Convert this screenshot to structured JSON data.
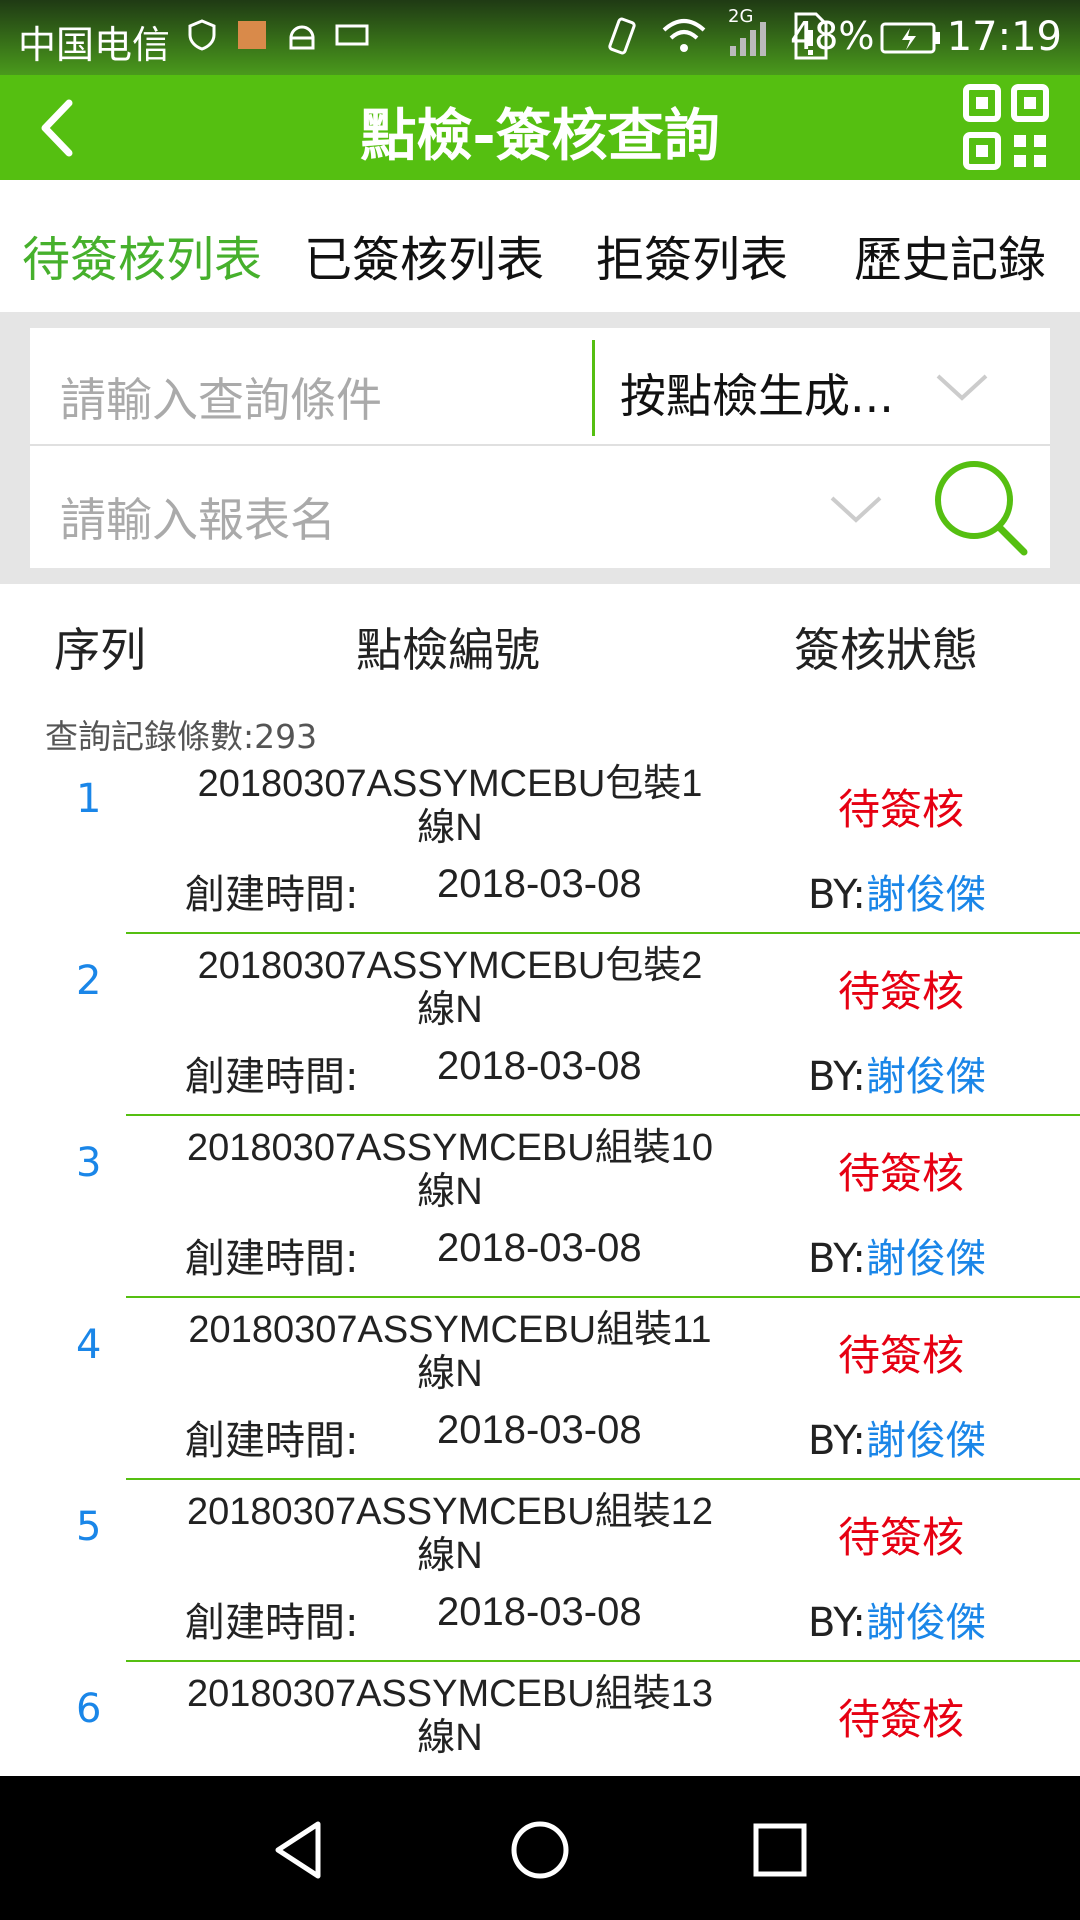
{
  "status_bar": {
    "carrier": "中国电信",
    "network": "2G",
    "battery": "48%",
    "time": "17:19"
  },
  "app_bar": {
    "title": "點檢-簽核查詢"
  },
  "tabs": [
    {
      "label": "待簽核列表",
      "active": true
    },
    {
      "label": "已簽核列表",
      "active": false
    },
    {
      "label": "拒簽列表",
      "active": false
    },
    {
      "label": "歷史記錄",
      "active": false
    }
  ],
  "filters": {
    "query_placeholder": "請輸入查詢條件",
    "sort_selected": "按點檢生成...",
    "report_placeholder": "請輸入報表名"
  },
  "list_header": {
    "col_index": "序列",
    "col_code": "點檢編號",
    "col_status": "簽核狀態"
  },
  "count": {
    "label": "查詢記錄條數:",
    "value": "293"
  },
  "record_labels": {
    "created_label": "創建時間:",
    "by_prefix": "BY:"
  },
  "records": [
    {
      "index": "1",
      "code": "20180307ASSYMCEBU包裝1線N",
      "status": "待簽核",
      "created": "2018-03-08",
      "by": "謝俊傑"
    },
    {
      "index": "2",
      "code": "20180307ASSYMCEBU包裝2線N",
      "status": "待簽核",
      "created": "2018-03-08",
      "by": "謝俊傑"
    },
    {
      "index": "3",
      "code": "20180307ASSYMCEBU組裝10線N",
      "status": "待簽核",
      "created": "2018-03-08",
      "by": "謝俊傑"
    },
    {
      "index": "4",
      "code": "20180307ASSYMCEBU組裝11線N",
      "status": "待簽核",
      "created": "2018-03-08",
      "by": "謝俊傑"
    },
    {
      "index": "5",
      "code": "20180307ASSYMCEBU組裝12線N",
      "status": "待簽核",
      "created": "2018-03-08",
      "by": "謝俊傑"
    },
    {
      "index": "6",
      "code": "20180307ASSYMCEBU組裝13線N",
      "status": "待簽核",
      "created": "",
      "by": ""
    }
  ],
  "colors": {
    "brand_green": "#55bf11",
    "active_tab": "#46b02c",
    "status_red": "#e60012",
    "link_blue": "#1a86e8"
  },
  "icons": [
    "back-arrow-icon",
    "qr-code-icon",
    "chevron-down-icon",
    "search-icon",
    "nav-back-icon",
    "nav-home-icon",
    "nav-recents-icon"
  ]
}
